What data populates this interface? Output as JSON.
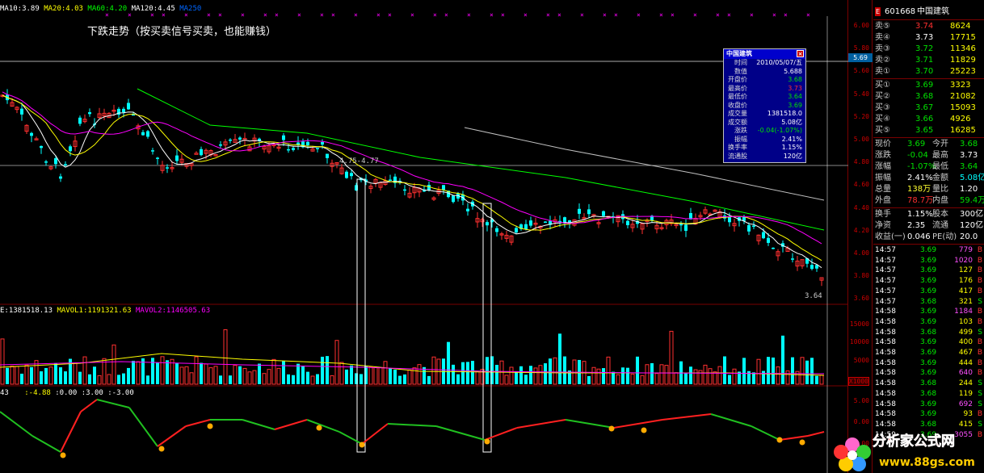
{
  "header": {
    "ma_labels": [
      {
        "text": "MA10:3.89",
        "color": "#ffffff"
      },
      {
        "text": "MA20:4.03",
        "color": "#ffff00"
      },
      {
        "text": "MA60:4.20",
        "color": "#00ff00"
      },
      {
        "text": "MA120:4.45",
        "color": "#ffffff"
      },
      {
        "text": "MA250",
        "color": "#0060ff"
      }
    ],
    "title_text": "下跌走势（按买卖信号买卖，也能赚钱）",
    "low_label": "3.64",
    "mid_label": "4.75-4.77"
  },
  "volume_header": {
    "vol": "E:1381518.13",
    "mavol1": "MAVOL1:1191321.63",
    "mavol2": "MAVOL2:1146505.63"
  },
  "indicator_header": {
    "a": "43",
    "b": ":-4.88",
    "c": ":0.00",
    "d": ":3.00",
    "e": ":-3.00"
  },
  "axis": {
    "price_ticks": [
      "6.00",
      "5.80",
      "5.60",
      "5.40",
      "5.20",
      "5.00",
      "4.80",
      "4.60",
      "4.40",
      "4.20",
      "4.00",
      "3.80",
      "3.60"
    ],
    "cursor_price": "5.69",
    "vol_ticks": [
      "15000",
      "10000",
      "5000"
    ],
    "vol_unit": "X1000",
    "ind_ticks": [
      "5.00",
      "0.00",
      "-5.00"
    ]
  },
  "popup": {
    "title": "中国建筑",
    "close": "×",
    "rows": [
      {
        "k": "时间",
        "v": "2010/05/07/五",
        "c": "wh"
      },
      {
        "k": "数值",
        "v": "5.688",
        "c": "wh"
      },
      {
        "k": "开盘价",
        "v": "3.68",
        "c": "gr"
      },
      {
        "k": "最高价",
        "v": "3.73",
        "c": "rd"
      },
      {
        "k": "最低价",
        "v": "3.64",
        "c": "gr"
      },
      {
        "k": "收盘价",
        "v": "3.69",
        "c": "gr"
      },
      {
        "k": "成交量",
        "v": "1381518.0",
        "c": "wh"
      },
      {
        "k": "成交额",
        "v": "5.08亿",
        "c": "wh"
      },
      {
        "k": "涨跌",
        "v": "-0.04(-1.07%)",
        "c": "gr"
      },
      {
        "k": "振幅",
        "v": "2.41%",
        "c": "wh"
      },
      {
        "k": "换手率",
        "v": "1.15%",
        "c": "wh"
      },
      {
        "k": "流通股",
        "v": "120亿",
        "c": "wh"
      }
    ]
  },
  "panel": {
    "code": "601668",
    "name": "中国建筑",
    "badge": "E",
    "asks": [
      {
        "label": "卖⑤",
        "price": "3.74",
        "vol": "8624",
        "pc": "rd"
      },
      {
        "label": "卖④",
        "price": "3.73",
        "vol": "17715",
        "pc": "wh"
      },
      {
        "label": "卖③",
        "price": "3.72",
        "vol": "11346",
        "pc": "gr"
      },
      {
        "label": "卖②",
        "price": "3.71",
        "vol": "11829",
        "pc": "gr"
      },
      {
        "label": "卖①",
        "price": "3.70",
        "vol": "25223",
        "pc": "gr"
      }
    ],
    "bids": [
      {
        "label": "买①",
        "price": "3.69",
        "vol": "3323",
        "pc": "gr"
      },
      {
        "label": "买②",
        "price": "3.68",
        "vol": "21082",
        "pc": "gr"
      },
      {
        "label": "买③",
        "price": "3.67",
        "vol": "15093",
        "pc": "gr"
      },
      {
        "label": "买④",
        "price": "3.66",
        "vol": "4926",
        "pc": "gr"
      },
      {
        "label": "买⑤",
        "price": "3.65",
        "vol": "16285",
        "pc": "gr"
      }
    ],
    "quote": [
      {
        "l1": "现价",
        "v1": "3.69",
        "c1": "gr",
        "l2": "今开",
        "v2": "3.68",
        "c2": "gr"
      },
      {
        "l1": "涨跌",
        "v1": "-0.04",
        "c1": "gr",
        "l2": "最高",
        "v2": "3.73",
        "c2": "wh"
      },
      {
        "l1": "涨幅",
        "v1": "-1.07%",
        "c1": "gr",
        "l2": "最低",
        "v2": "3.64",
        "c2": "gr"
      },
      {
        "l1": "振幅",
        "v1": "2.41%",
        "c1": "wh",
        "l2": "金额",
        "v2": "5.08亿",
        "c2": "cy"
      },
      {
        "l1": "总量",
        "v1": "138万",
        "c1": "yl",
        "l2": "量比",
        "v2": "1.20",
        "c2": "wh"
      },
      {
        "l1": "外盘",
        "v1": "78.7万",
        "c1": "rd",
        "l2": "内盘",
        "v2": "59.4万",
        "c2": "gr"
      }
    ],
    "fund": [
      {
        "l1": "换手",
        "v1": "1.15%",
        "l2": "股本",
        "v2": "300亿"
      },
      {
        "l1": "净资",
        "v1": "2.35",
        "l2": "流通",
        "v2": "120亿"
      },
      {
        "l1": "收益(一)",
        "v1": "0.046",
        "l2": "PE(动)",
        "v2": "20.0"
      }
    ],
    "ticks": [
      {
        "t": "14:57",
        "p": "3.69",
        "v": "779",
        "s": "B"
      },
      {
        "t": "14:57",
        "p": "3.69",
        "v": "1020",
        "s": "B"
      },
      {
        "t": "14:57",
        "p": "3.69",
        "v": "127",
        "s": "B"
      },
      {
        "t": "14:57",
        "p": "3.69",
        "v": "176",
        "s": "B"
      },
      {
        "t": "14:57",
        "p": "3.69",
        "v": "417",
        "s": "B"
      },
      {
        "t": "14:57",
        "p": "3.68",
        "v": "321",
        "s": "S"
      },
      {
        "t": "14:58",
        "p": "3.69",
        "v": "1184",
        "s": "B"
      },
      {
        "t": "14:58",
        "p": "3.69",
        "v": "103",
        "s": "B"
      },
      {
        "t": "14:58",
        "p": "3.68",
        "v": "499",
        "s": "S"
      },
      {
        "t": "14:58",
        "p": "3.69",
        "v": "400",
        "s": "B"
      },
      {
        "t": "14:58",
        "p": "3.69",
        "v": "467",
        "s": "B"
      },
      {
        "t": "14:58",
        "p": "3.69",
        "v": "444",
        "s": "B"
      },
      {
        "t": "14:58",
        "p": "3.69",
        "v": "640",
        "s": "B"
      },
      {
        "t": "14:58",
        "p": "3.68",
        "v": "244",
        "s": "S"
      },
      {
        "t": "14:58",
        "p": "3.68",
        "v": "119",
        "s": "S"
      },
      {
        "t": "14:58",
        "p": "3.69",
        "v": "692",
        "s": "S"
      },
      {
        "t": "14:58",
        "p": "3.69",
        "v": "93",
        "s": "B"
      },
      {
        "t": "14:58",
        "p": "3.68",
        "v": "415",
        "s": "S"
      },
      {
        "t": "14:59",
        "p": "3.69",
        "v": "3055",
        "s": "B"
      }
    ]
  },
  "watermark": {
    "brand": "分析家公式网",
    "url": "www.88gs.com"
  },
  "colors": {
    "up": "#ff3030",
    "down": "#00ffff",
    "ma5": "#ffffff",
    "ma10": "#ffff00",
    "ma20": "#ff00ff",
    "ma60": "#00ff00",
    "ma120": "#c0c0c0"
  }
}
